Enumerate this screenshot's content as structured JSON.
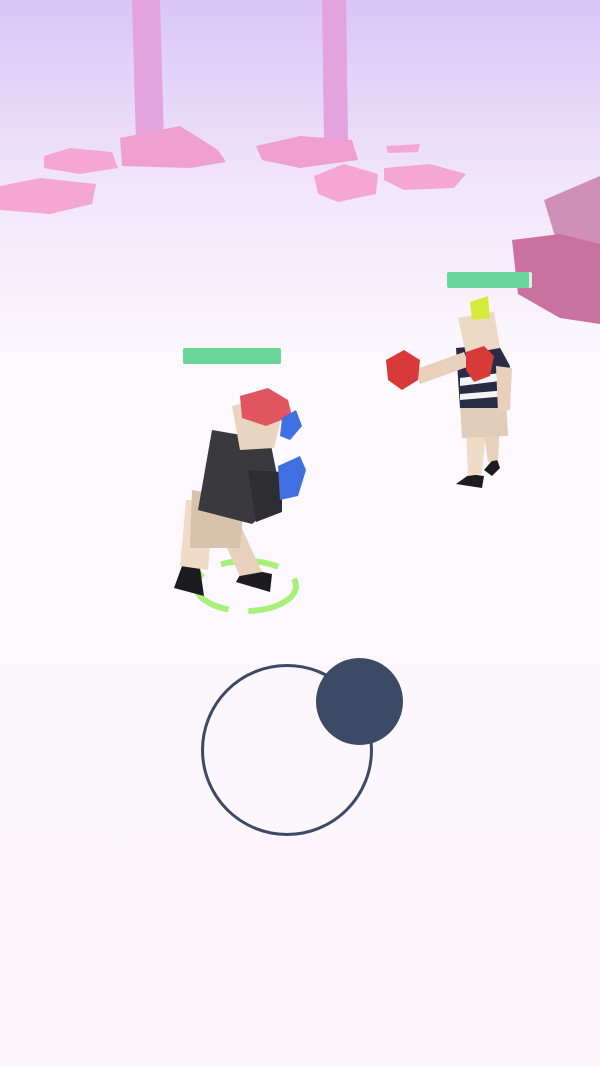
{
  "game": {
    "scene": "boxing-arena",
    "colors": {
      "sky_top": "#dcc8f8",
      "floor": "#fdf8fd",
      "rocks": "#f1a2cf",
      "health": "#6ad69a",
      "health_track": "#e8e8e8",
      "player_target_ring": "#a8f07a",
      "joystick": "#3d4a66"
    },
    "player": {
      "health_fraction": 1.0,
      "cap_color": "#e05560",
      "glove_color": "#3f6fe0",
      "shirt_color": "#3a3a3e"
    },
    "enemy": {
      "health_fraction": 0.97,
      "hair_color": "#d6ea3a",
      "glove_color": "#d83a3a",
      "shirt_color": "#2a2b45"
    },
    "joystick": {
      "icon": "virtual-joystick",
      "direction": "up-right"
    }
  }
}
